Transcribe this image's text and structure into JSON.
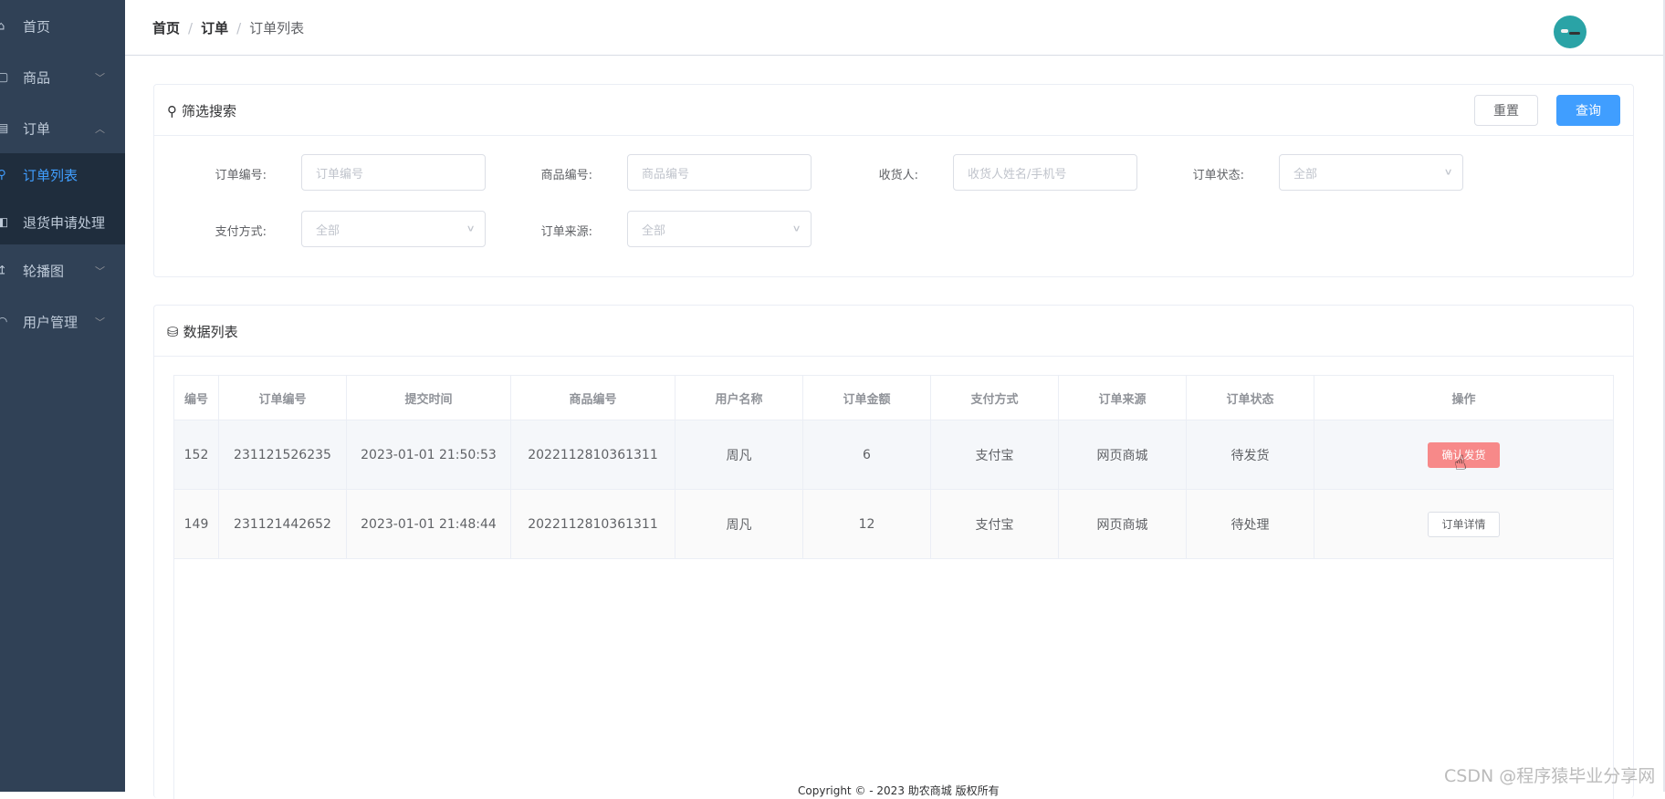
{
  "sidebar": {
    "items": [
      {
        "label": "首页",
        "icon": "home-icon"
      },
      {
        "label": "商品",
        "icon": "goods-icon",
        "arrow": "chevron-down"
      },
      {
        "label": "订单",
        "icon": "order-icon",
        "arrow": "chevron-up"
      },
      {
        "label": "订单列表",
        "icon": "list-icon",
        "active": true
      },
      {
        "label": "退货申请处理",
        "icon": "return-icon"
      },
      {
        "label": "轮播图",
        "icon": "carousel-icon",
        "arrow": "chevron-down"
      },
      {
        "label": "用户管理",
        "icon": "user-icon",
        "arrow": "chevron-down"
      }
    ],
    "colors": {
      "bg": "#304156",
      "submenu_bg": "#1f2d3d",
      "text": "#bfcbd9",
      "active": "#409eff"
    }
  },
  "header": {
    "breadcrumb": [
      "首页",
      "订单",
      "订单列表"
    ],
    "separator": "/"
  },
  "filter": {
    "title": "筛选搜索",
    "reset_label": "重置",
    "query_label": "查询",
    "fields": {
      "order_no": {
        "label": "订单编号:",
        "placeholder": "订单编号"
      },
      "product_no": {
        "label": "商品编号:",
        "placeholder": "商品编号"
      },
      "receiver": {
        "label": "收货人:",
        "placeholder": "收货人姓名/手机号"
      },
      "status": {
        "label": "订单状态:",
        "value": "全部"
      },
      "pay_type": {
        "label": "支付方式:",
        "value": "全部"
      },
      "source": {
        "label": "订单来源:",
        "value": "全部"
      }
    }
  },
  "data_list": {
    "title": "数据列表",
    "columns": [
      "编号",
      "订单编号",
      "提交时间",
      "商品编号",
      "用户名称",
      "订单金额",
      "支付方式",
      "订单来源",
      "订单状态",
      "操作"
    ],
    "rows": [
      {
        "id": "152",
        "order_no": "231121526235",
        "time": "2023-01-01 21:50:53",
        "product_no": "2022112810361311",
        "user": "周凡",
        "amount": "6",
        "pay": "支付宝",
        "source": "网页商城",
        "status": "待发货",
        "action": "确认发货"
      },
      {
        "id": "149",
        "order_no": "231121442652",
        "time": "2023-01-01 21:48:44",
        "product_no": "2022112810361311",
        "user": "周凡",
        "amount": "12",
        "pay": "支付宝",
        "source": "网页商城",
        "status": "待处理",
        "action": "订单详情"
      }
    ]
  },
  "footer": {
    "text": "Copyright © - 2023  助农商城 版权所有"
  },
  "watermark": "CSDN @程序猿毕业分享网",
  "colors": {
    "primary": "#409eff",
    "danger": "#f78989",
    "border": "#ebeef5"
  }
}
